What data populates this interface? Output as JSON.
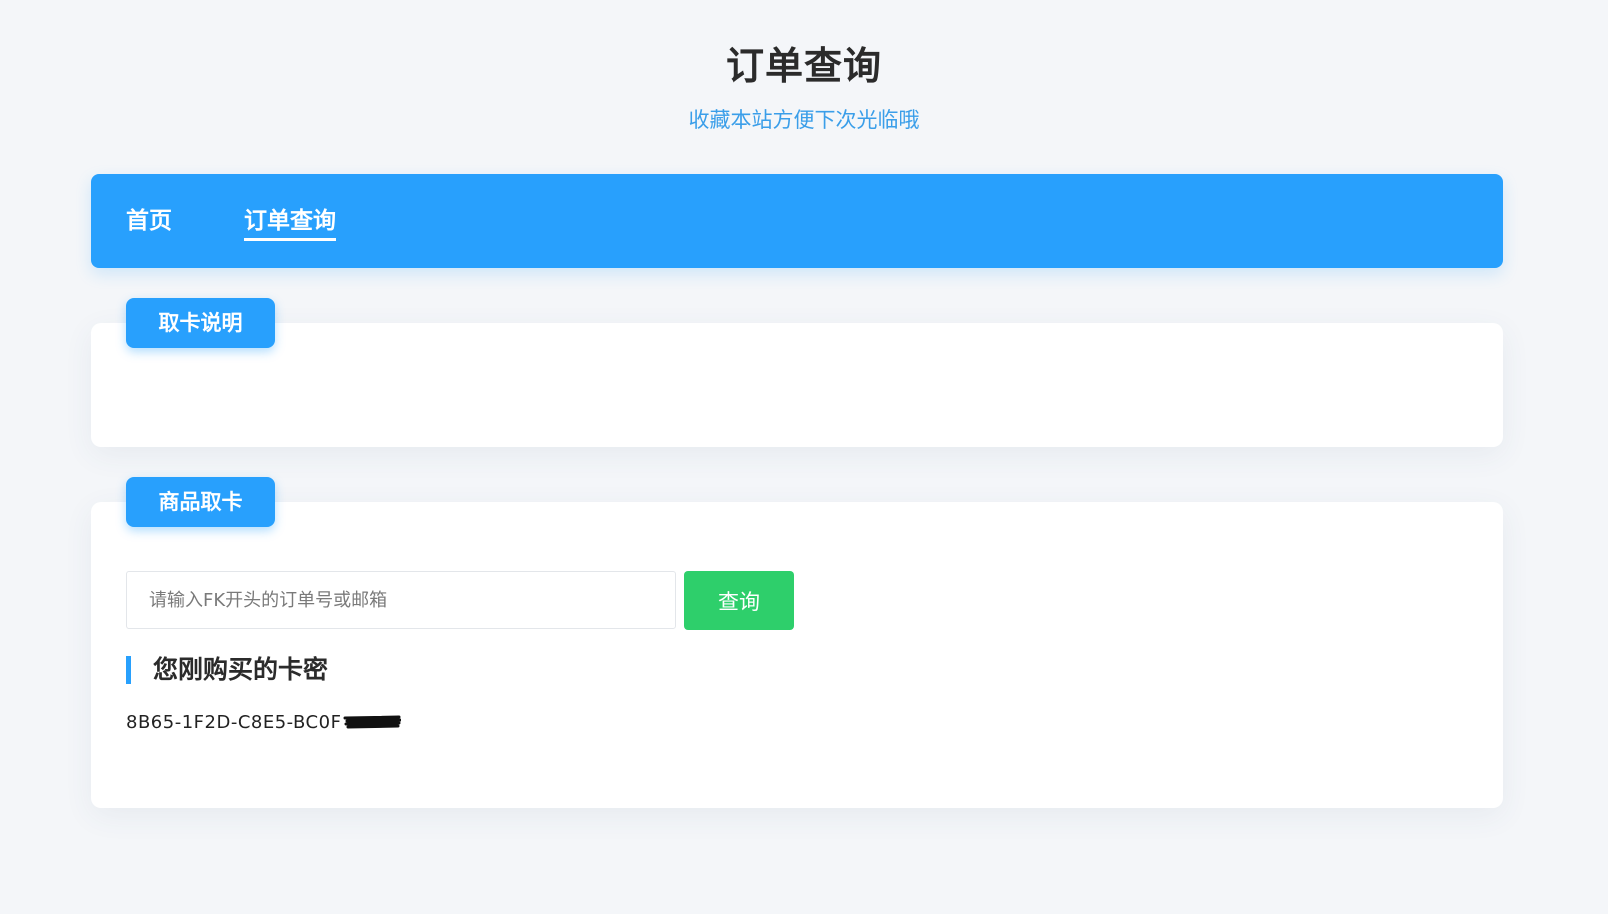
{
  "header": {
    "title": "订单查询",
    "subtitle": "收藏本站方便下次光临哦"
  },
  "nav": {
    "items": [
      {
        "label": "首页",
        "active": false
      },
      {
        "label": "订单查询",
        "active": true
      }
    ]
  },
  "info_card": {
    "tag": "取卡说明"
  },
  "fetch_card": {
    "tag": "商品取卡",
    "search": {
      "placeholder": "请输入FK开头的订单号或邮箱",
      "value": ""
    },
    "button_label": "查询",
    "result_heading": "您刚购买的卡密",
    "card_key_visible": "8B65-1F2D-C8E5-BC0F"
  },
  "colors": {
    "primary": "#28a0fd",
    "success": "#2ecf6b",
    "subtitle": "#3a9ee9",
    "background": "#f4f6f9"
  },
  "icons": {
    "redaction": "scribble-redaction"
  }
}
